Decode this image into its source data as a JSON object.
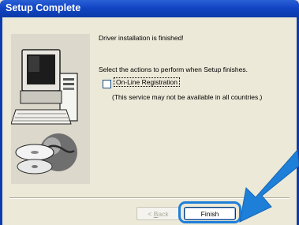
{
  "window": {
    "title": "Setup Complete"
  },
  "content": {
    "message": "Driver installation is finished!",
    "prompt": "Select the actions to perform when Setup finishes.",
    "checkbox_label": "On-Line Registration",
    "checkbox_checked": false,
    "note": "(This service may not be available in all countries.)"
  },
  "buttons": {
    "back_prefix": "< ",
    "back_accel": "B",
    "back_rest": "ack",
    "finish": "Finish"
  },
  "colors": {
    "title_bar": "#1245c4",
    "dialog_bg": "#ece9d8",
    "highlight_arrow": "#1e7fd9"
  },
  "icons": {
    "illustration": "computer-with-cd-and-globe-icon",
    "highlight": "pointer-arrow-icon"
  }
}
